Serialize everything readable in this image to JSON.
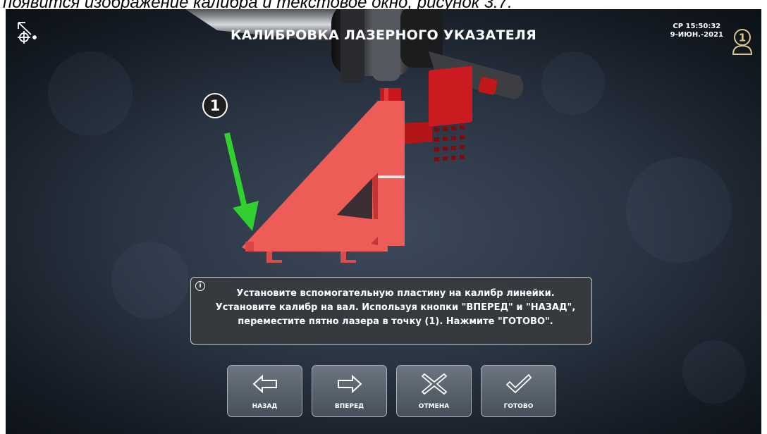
{
  "caption": "появится изображение калибра и текстовое окно, рисунок 3.7.",
  "header": {
    "title": "КАЛИБРОВКА ЛАЗЕРНОГО УКАЗАТЕЛЯ",
    "time": "СР 15:50:32",
    "date": "9-ИЮН.-2021",
    "user_badge": "1"
  },
  "icons": {
    "tool": "laser-pointer-icon",
    "user": "operator-icon",
    "info": "info-icon"
  },
  "scene": {
    "marker_label": "1",
    "arrow_color": "#2fd02f",
    "gauge_color": "#e84a4a"
  },
  "info": {
    "symbol": "i",
    "lines": [
      "Установите вспомогательную пластину на калибр линейки.",
      "Установите калибр на вал. Используя кнопки \"ВПЕРЕД\" и \"НАЗАД\",",
      "переместите пятно лазера в точку (1). Нажмите \"ГОТОВО\"."
    ]
  },
  "buttons": {
    "back": "НАЗАД",
    "forward": "ВПЕРЕД",
    "cancel": "ОТМЕНА",
    "done": "ГОТОВО"
  }
}
